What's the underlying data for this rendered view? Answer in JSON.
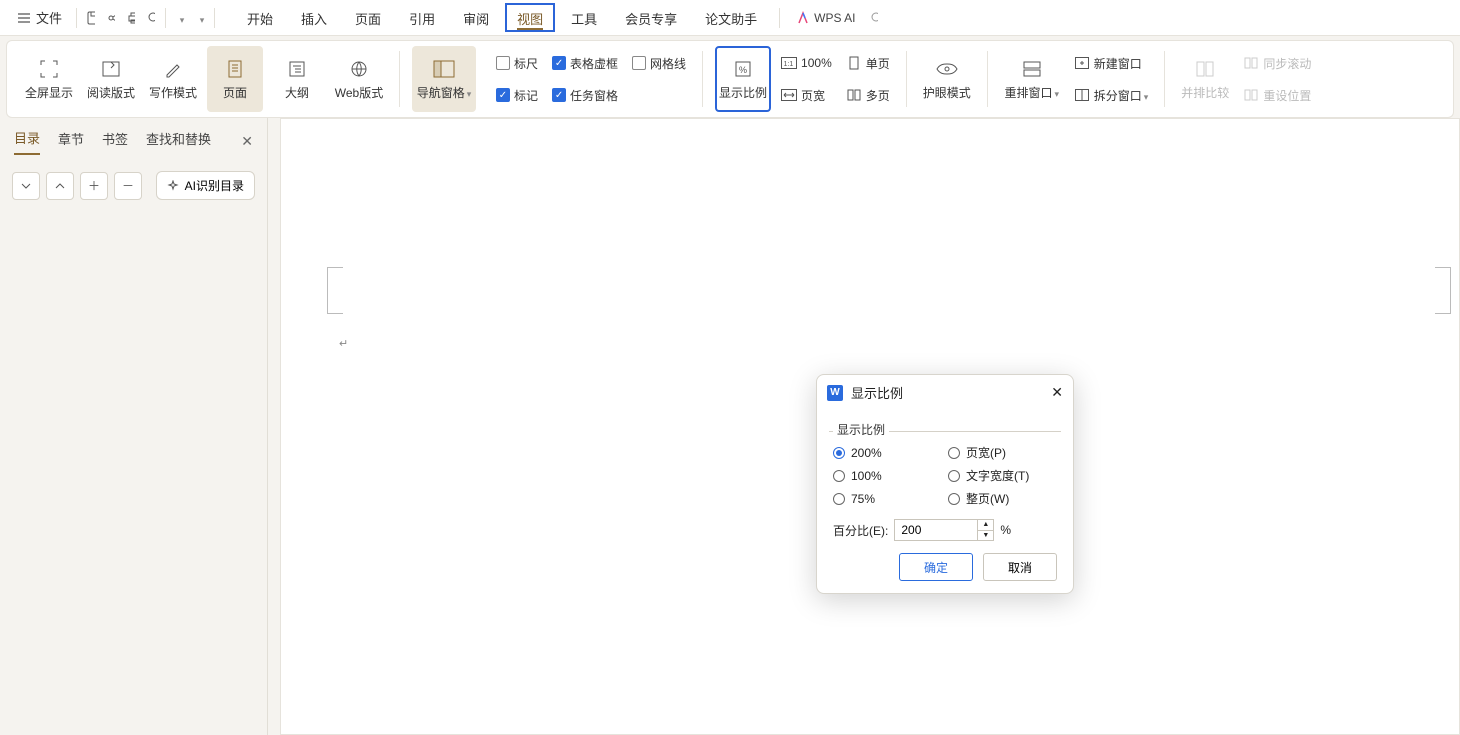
{
  "menubar": {
    "file_label": "文件",
    "tabs": [
      "开始",
      "插入",
      "页面",
      "引用",
      "审阅",
      "视图",
      "工具",
      "会员专享",
      "论文助手"
    ],
    "active_tab": "视图",
    "wps_ai": "WPS AI"
  },
  "ribbon": {
    "view_group": {
      "fullscreen": "全屏显示",
      "read_layout": "阅读版式",
      "write_mode": "写作模式",
      "page": "页面",
      "outline": "大纲",
      "web_layout": "Web版式"
    },
    "nav_pane": "导航窗格",
    "checks": {
      "ruler": "标尺",
      "mark": "标记",
      "table_frame": "表格虚框",
      "task_pane": "任务窗格",
      "gridlines": "网格线"
    },
    "zoom": {
      "label": "显示比例",
      "hundred": "100%",
      "page_width": "页宽",
      "single_page": "单页",
      "multi_page": "多页"
    },
    "eyecare": "护眼模式",
    "window": {
      "rearrange": "重排窗口",
      "new_window": "新建窗口",
      "split_window": "拆分窗口"
    },
    "compare": {
      "side_by_side": "并排比较",
      "sync_scroll": "同步滚动",
      "reset_pos": "重设位置"
    }
  },
  "sidebar": {
    "tabs": {
      "toc": "目录",
      "chapter": "章节",
      "bookmark": "书签",
      "find_replace": "查找和替换"
    },
    "ai_rec": "AI识别目录"
  },
  "dialog": {
    "title": "显示比例",
    "section": "显示比例",
    "opts": {
      "p200": "200%",
      "p100": "100%",
      "p75": "75%",
      "page_width": "页宽(P)",
      "text_width": "文字宽度(T)",
      "whole_page": "整页(W)"
    },
    "percent_label": "百分比(E):",
    "percent_value": "200",
    "percent_sign": "%",
    "ok": "确定",
    "cancel": "取消"
  }
}
